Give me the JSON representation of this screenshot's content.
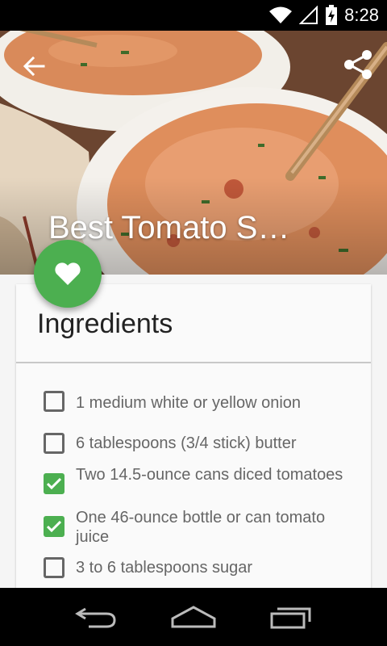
{
  "status_bar": {
    "time": "8:28"
  },
  "hero": {
    "title": "Best Tomato S…"
  },
  "card": {
    "heading": "Ingredients",
    "items": [
      {
        "text": "1 medium white or yellow onion",
        "checked": false
      },
      {
        "text": "6 tablespoons (3/4 stick) butter",
        "checked": false
      },
      {
        "text": " Two 14.5-ounce cans diced tomatoes",
        "checked": true
      },
      {
        "text": " One 46-ounce bottle or can tomato juice",
        "checked": true
      },
      {
        "text": "3 to 6 tablespoons sugar",
        "checked": false
      }
    ]
  },
  "colors": {
    "accent": "#4caf50",
    "text": "#666666",
    "heading": "#222222"
  }
}
